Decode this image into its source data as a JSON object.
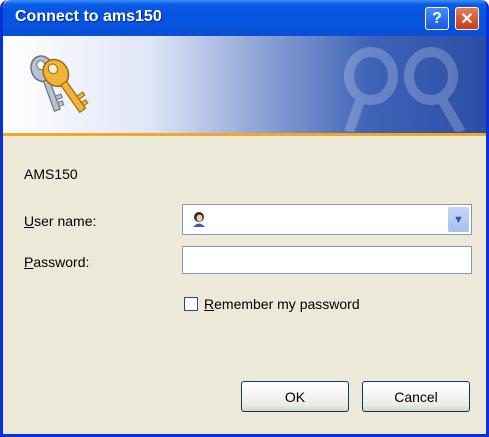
{
  "window": {
    "title": "Connect to ams150"
  },
  "titlebar": {
    "help_symbol": "?",
    "close_symbol": "✕"
  },
  "banner": {
    "icon": "keys-icon"
  },
  "dialog": {
    "server_name": "AMS150",
    "username_label_accel": "U",
    "username_label_rest": "ser name:",
    "username_value": "",
    "password_label_accel": "P",
    "password_label_rest": "assword:",
    "password_value": "",
    "remember_accel": "R",
    "remember_rest": "emember my password",
    "remember_checked": false,
    "ok_label": "OK",
    "cancel_label": "Cancel"
  },
  "colors": {
    "titlebar": "#0a54e0",
    "window_bg": "#ece9d8",
    "banner_accent": "#f5a623",
    "close_button": "#c63b18"
  }
}
